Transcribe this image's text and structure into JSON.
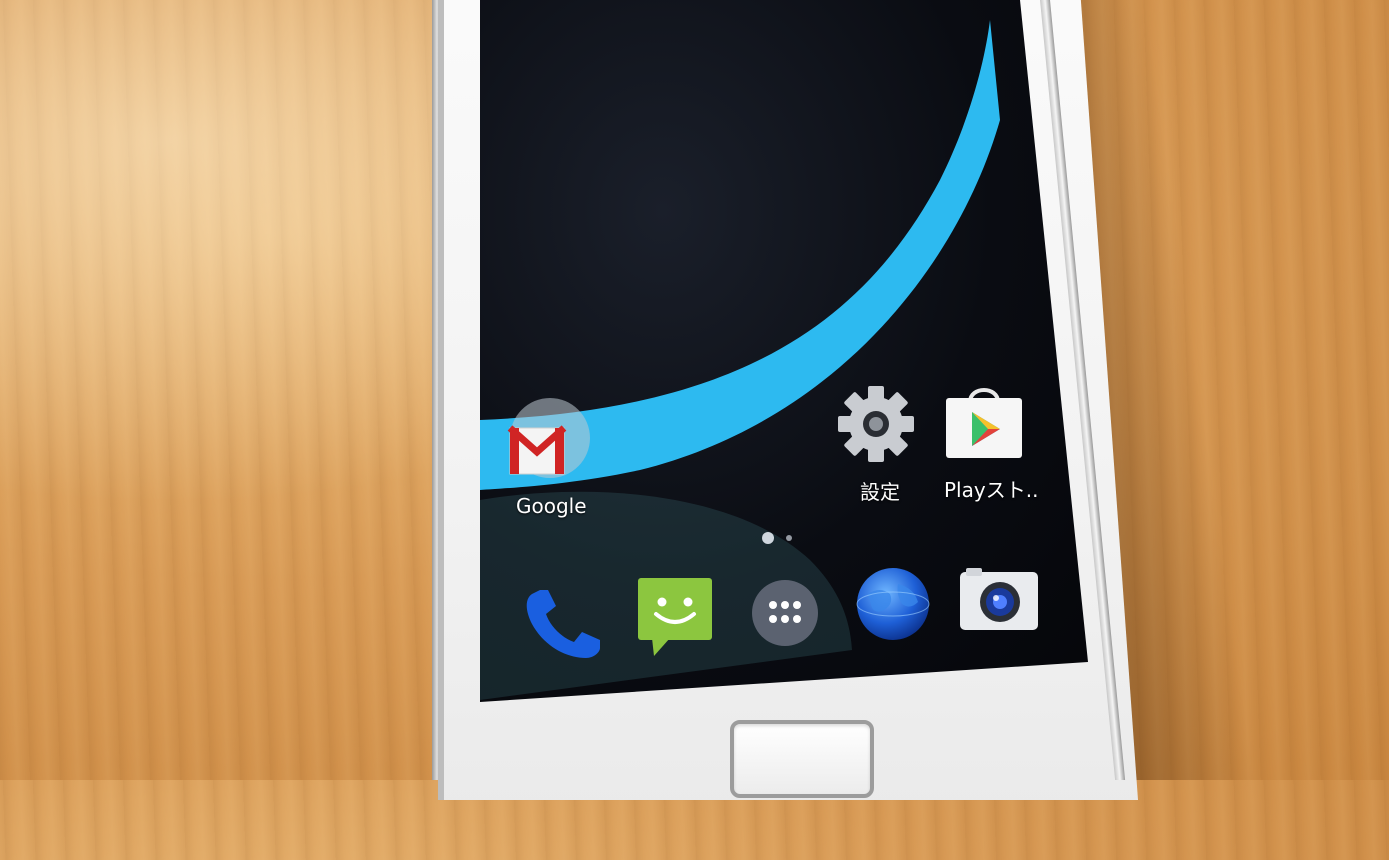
{
  "home_screen": {
    "folder": {
      "label": "Google",
      "icon": "gmail-icon"
    },
    "apps": [
      {
        "key": "settings",
        "label": "設定",
        "icon": "gear-icon"
      },
      {
        "key": "play_store",
        "label": "Playスト..",
        "icon": "play-store-icon"
      }
    ],
    "page_indicator": {
      "pages": 2,
      "current": 1
    }
  },
  "dock": [
    {
      "key": "phone",
      "icon": "phone-icon"
    },
    {
      "key": "messaging",
      "icon": "messaging-icon"
    },
    {
      "key": "app_drawer",
      "icon": "app-drawer-icon"
    },
    {
      "key": "browser",
      "icon": "globe-icon"
    },
    {
      "key": "camera",
      "icon": "camera-icon"
    }
  ],
  "colors": {
    "wallpaper_accent": "#2dbaf0",
    "screen_bg": "#0a0c12",
    "desk": "#d89a55",
    "messaging_green": "#8cc63f",
    "phone_blue": "#1a5fe0"
  }
}
